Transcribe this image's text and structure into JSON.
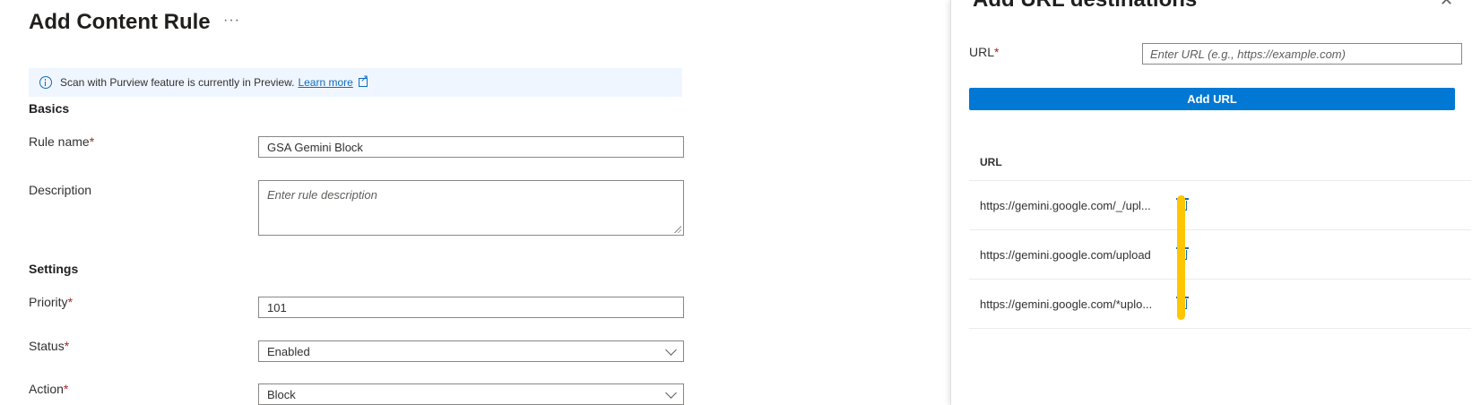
{
  "page": {
    "title": "Add Content Rule",
    "more_label": "···"
  },
  "banner": {
    "text": "Scan with Purview feature is currently in Preview.",
    "link": "Learn more"
  },
  "basics": {
    "heading": "Basics",
    "rule_name_label": "Rule name",
    "rule_name_value": "GSA Gemini Block",
    "description_label": "Description",
    "description_placeholder": "Enter rule description"
  },
  "settings": {
    "heading": "Settings",
    "priority_label": "Priority",
    "priority_value": "101",
    "status_label": "Status",
    "status_value": "Enabled",
    "action_label": "Action",
    "action_value": "Block"
  },
  "required_marker": "*",
  "panel": {
    "title": "Add URL destinations",
    "close": "✕",
    "url_label": "URL",
    "url_placeholder": "Enter URL (e.g., https://example.com)",
    "add_button": "Add URL",
    "table_header": "URL",
    "rows": [
      {
        "url": "https://gemini.google.com/_/upl..."
      },
      {
        "url": "https://gemini.google.com/upload"
      },
      {
        "url": "https://gemini.google.com/*uplo..."
      }
    ]
  },
  "colors": {
    "accent": "#0078d4",
    "link": "#0f6cbd",
    "required": "#a4262c",
    "highlight": "#ffc600",
    "banner_bg": "#f0f6ff"
  }
}
